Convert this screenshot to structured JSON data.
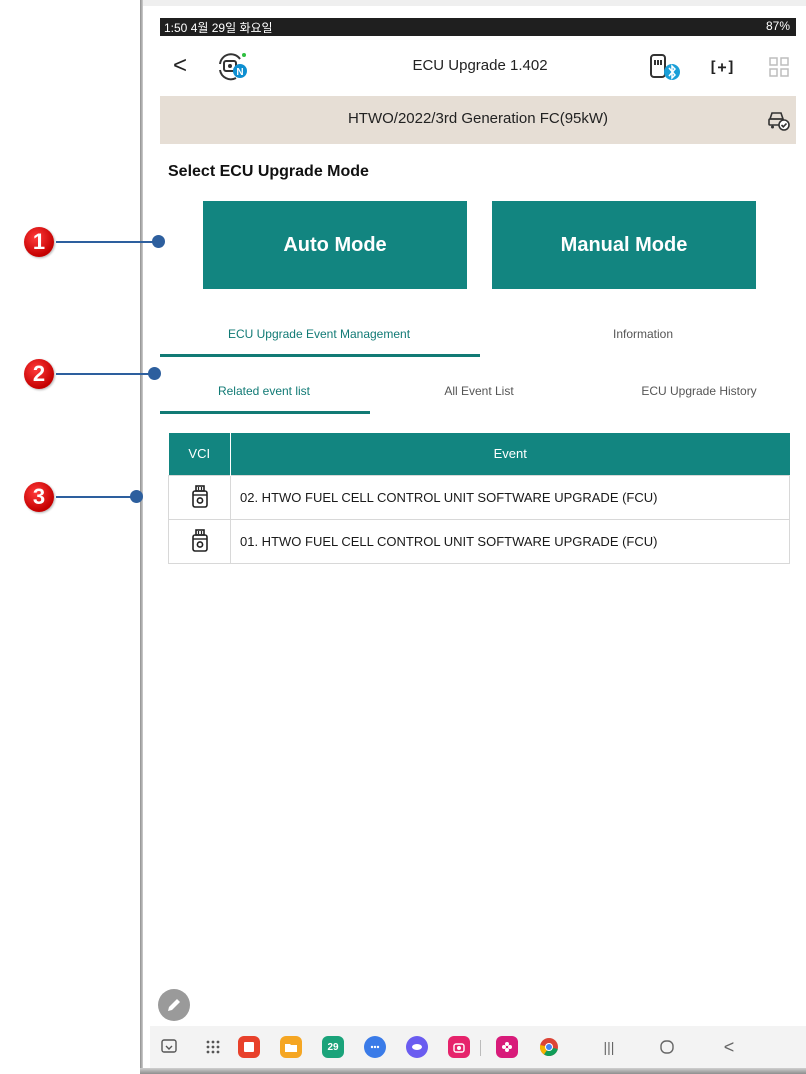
{
  "status_bar": {
    "time": "1:50  4월 29일 화요일",
    "right": "87%"
  },
  "header": {
    "title": "ECU Upgrade 1.402",
    "back_glyph": "<",
    "expand_glyph": "[+]",
    "icons": [
      "back-icon",
      "ecu-logo-icon",
      "vci-bluetooth-icon",
      "expand-icon",
      "grid-icon"
    ]
  },
  "vehicle": {
    "name": "HTWO/2022/3rd Generation FC(95kW)"
  },
  "mode_section": {
    "heading": "Select ECU Upgrade Mode",
    "auto_label": "Auto Mode",
    "manual_label": "Manual Mode"
  },
  "tabs": [
    {
      "label": "ECU Upgrade Event Management",
      "active": true
    },
    {
      "label": "Information",
      "active": false
    }
  ],
  "subtabs": [
    {
      "label": "Related event list",
      "active": true
    },
    {
      "label": "All Event List",
      "active": false
    },
    {
      "label": "ECU Upgrade History",
      "active": false
    }
  ],
  "event_table": {
    "headers": [
      "VCI",
      "Event"
    ],
    "rows": [
      {
        "vci_icon": "vci-device-icon",
        "event": "02. HTWO FUEL CELL CONTROL UNIT SOFTWARE UPGRADE (FCU)"
      },
      {
        "vci_icon": "vci-device-icon",
        "event": "01. HTWO FUEL CELL CONTROL UNIT SOFTWARE UPGRADE (FCU)"
      }
    ]
  },
  "annotations": [
    "1",
    "2",
    "3"
  ],
  "nav_bar": {
    "calendar_day": "29",
    "recents_glyph": "|||",
    "back_glyph": "<"
  },
  "colors": {
    "teal": "#128580",
    "banner": "#e6ded5",
    "marker_red": "#d60000",
    "pointer_blue": "#2d5f9e"
  }
}
